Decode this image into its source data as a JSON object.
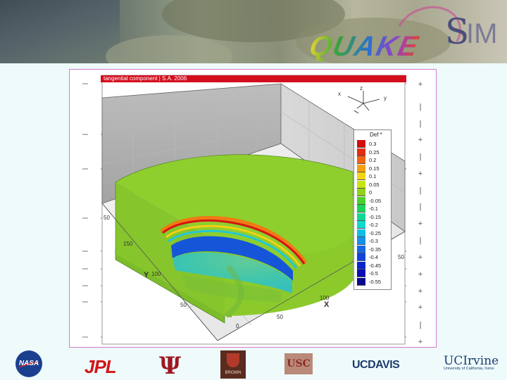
{
  "banner": {
    "logo_prefix": "QUAKE",
    "logo_s": "S",
    "logo_suffix": "IM"
  },
  "figure": {
    "title": "tangential component  |  S.A. 2006",
    "legend_title": "Def *",
    "legend": [
      {
        "label": "0.3",
        "color": "#d10f0f"
      },
      {
        "label": "0.25",
        "color": "#e42c10"
      },
      {
        "label": "0.2",
        "color": "#f06412"
      },
      {
        "label": "0.15",
        "color": "#f5a012"
      },
      {
        "label": "0.1",
        "color": "#f3d414"
      },
      {
        "label": "0.05",
        "color": "#c8e414"
      },
      {
        "label": "0",
        "color": "#8fd31a"
      },
      {
        "label": "-0.05",
        "color": "#4bd12b"
      },
      {
        "label": "-0.1",
        "color": "#1ed35a"
      },
      {
        "label": "-0.15",
        "color": "#12d696"
      },
      {
        "label": "-0.2",
        "color": "#10d8cd"
      },
      {
        "label": "-0.25",
        "color": "#12bce6"
      },
      {
        "label": "-0.3",
        "color": "#1592e8"
      },
      {
        "label": "-0.35",
        "color": "#1569e3"
      },
      {
        "label": "-0.4",
        "color": "#1244d9"
      },
      {
        "label": "-0.45",
        "color": "#0c25c9"
      },
      {
        "label": "-0.5",
        "color": "#0a0cb4"
      },
      {
        "label": "-0.55",
        "color": "#0a0a8f"
      }
    ],
    "axis": {
      "y_label": "Y",
      "x_label": "X",
      "y_ticks": [
        "150",
        "100",
        "50"
      ],
      "x_ticks": [
        "100",
        "50",
        "0"
      ],
      "side_tick": "50",
      "left_tick": "50",
      "orient": {
        "x": "x",
        "y": "y",
        "z": "z"
      }
    }
  },
  "footer": {
    "nasa": "NASA",
    "jpl": "JPL",
    "iu": "Ψ",
    "brown": "BROWN",
    "usc": "USC",
    "ucdavis_a": "UC",
    "ucdavis_b": "DAVIS",
    "ucirvine": "UCIrvine",
    "ucirvine_sub": "University of California, Irvine"
  }
}
